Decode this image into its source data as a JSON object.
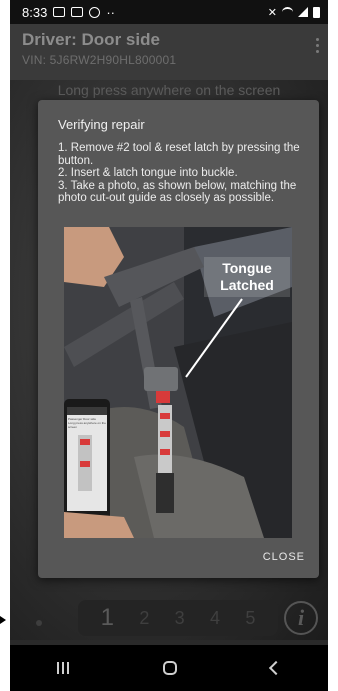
{
  "status_bar": {
    "time": "8:33"
  },
  "header": {
    "title": "Driver: Door side",
    "vin": "VIN: 5J6RW2H90HL800001"
  },
  "hint": "Long press anywhere on the screen",
  "dialog": {
    "title": "Verifying repair",
    "steps": [
      "1. Remove #2 tool & reset latch by pressing the button.",
      "2. Insert & latch tongue into buckle.",
      "3. Take a photo, as shown below, matching the photo cut-out guide as closely as possible."
    ],
    "photo_label_line1": "Tongue",
    "photo_label_line2": "Latched",
    "close_label": "CLOSE"
  },
  "stepper": {
    "items": [
      "1",
      "2",
      "3",
      "4",
      "5"
    ],
    "active": "1"
  },
  "info_label": "i",
  "phone_in_photo": {
    "title": "Passenger Door side",
    "subtitle": "Long press anywhere on the screen"
  }
}
